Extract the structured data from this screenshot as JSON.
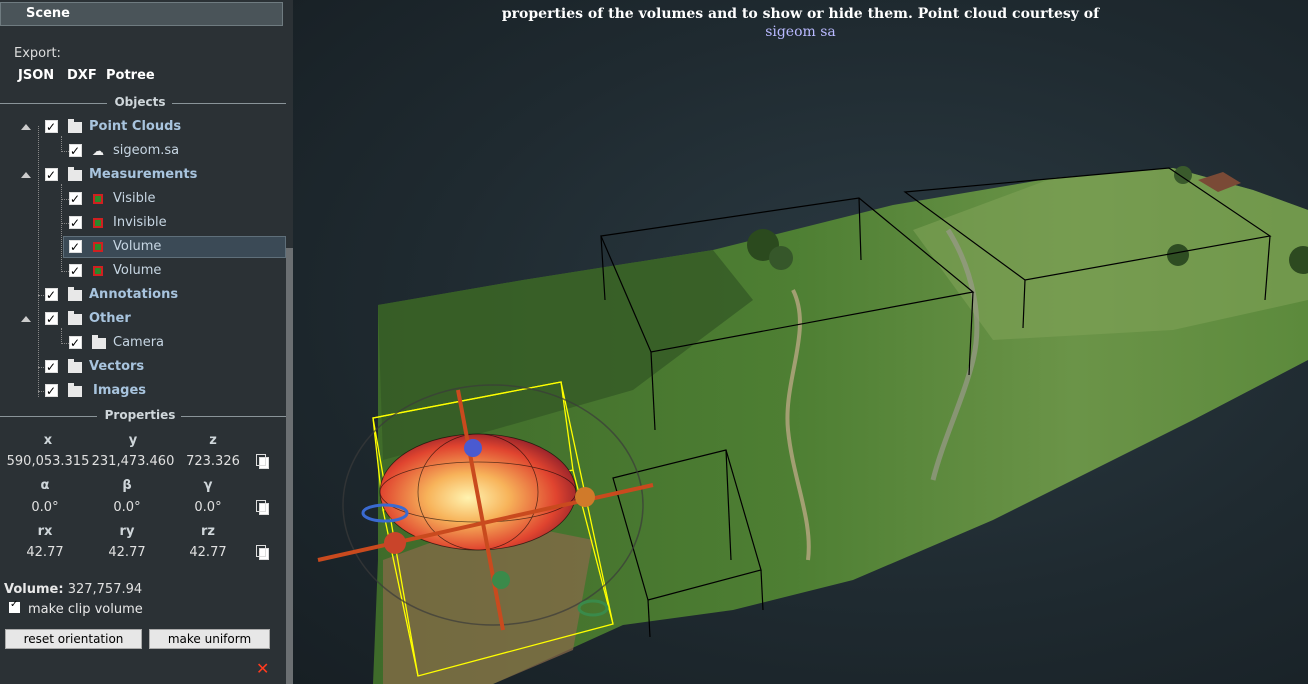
{
  "scene_tab": "Scene",
  "export": {
    "label": "Export:",
    "links": [
      "JSON",
      "DXF",
      "Potree"
    ]
  },
  "objects_header": "Objects",
  "tree": {
    "point_clouds": "Point Clouds",
    "sigeom": "sigeom.sa",
    "measurements": "Measurements",
    "visible": "Visible",
    "invisible": "Invisible",
    "volume1": "Volume",
    "volume2": "Volume",
    "annotations": "Annotations",
    "other": "Other",
    "camera": "Camera",
    "vectors": "Vectors",
    "images": "Images"
  },
  "properties_header": "Properties",
  "position": {
    "x_label": "x",
    "y_label": "y",
    "z_label": "z",
    "x": "590,053.315",
    "y": "231,473.460",
    "z": "723.326"
  },
  "rotation": {
    "a_label": "α",
    "b_label": "β",
    "g_label": "γ",
    "a": "0.0°",
    "b": "0.0°",
    "g": "0.0°"
  },
  "scale": {
    "rx_label": "rx",
    "ry_label": "ry",
    "rz_label": "rz",
    "rx": "42.77",
    "ry": "42.77",
    "rz": "42.77"
  },
  "volume": {
    "label": "Volume:",
    "value": "327,757.94"
  },
  "clip_label": "make clip volume",
  "buttons": {
    "reset": "reset orientation",
    "uniform": "make uniform"
  },
  "close_glyph": "✕",
  "info": {
    "line1": "properties of the volumes and to show or hide them. Point cloud courtesy of",
    "link": "sigeom sa"
  },
  "colors": {
    "sidebar_bg": "#2b3135",
    "group_text": "#a8c4de",
    "close": "#ff3b1f"
  }
}
